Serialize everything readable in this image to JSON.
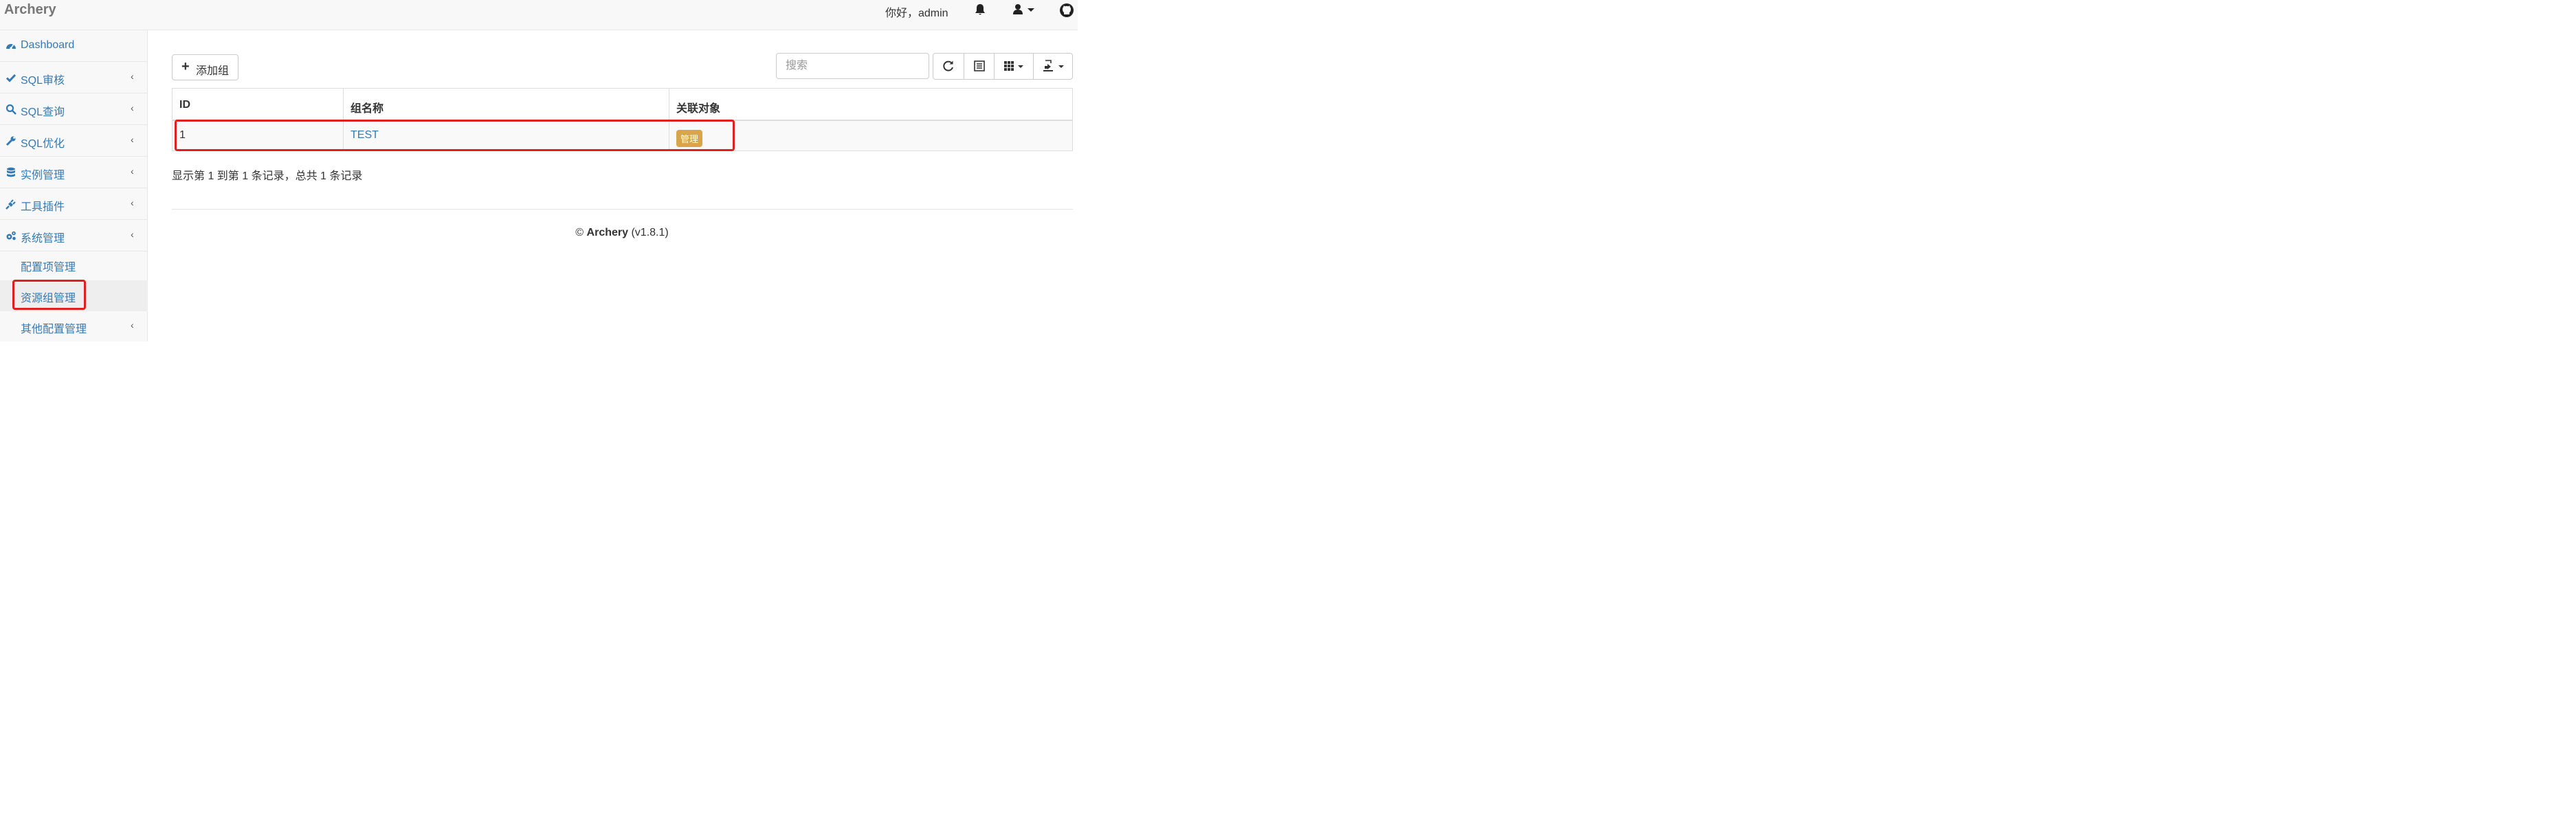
{
  "navbar": {
    "brand": "Archery",
    "greeting": "你好，admin",
    "icons": [
      "bell-icon",
      "user-icon",
      "github-icon"
    ]
  },
  "sidebar": {
    "items": [
      {
        "label": "Dashboard",
        "icon": "dashboard-icon"
      },
      {
        "label": "SQL审核",
        "icon": "check-icon",
        "chevron": "‹"
      },
      {
        "label": "SQL查询",
        "icon": "search-icon",
        "chevron": "‹"
      },
      {
        "label": "SQL优化",
        "icon": "wrench-icon",
        "chevron": "‹"
      },
      {
        "label": "实例管理",
        "icon": "database-icon",
        "chevron": "‹"
      },
      {
        "label": "工具插件",
        "icon": "plug-icon",
        "chevron": "‹"
      },
      {
        "label": "系统管理",
        "icon": "cogs-icon",
        "chevron": "‹"
      }
    ],
    "sub_items": [
      {
        "label": "配置项管理"
      },
      {
        "label": "资源组管理",
        "active": true
      },
      {
        "label": "其他配置管理",
        "chevron": "‹"
      }
    ]
  },
  "toolbar": {
    "add_label": "添加组",
    "search_placeholder": "搜索",
    "buttons": [
      "refresh-icon",
      "list-icon",
      "columns-icon",
      "export-icon"
    ]
  },
  "table": {
    "columns": [
      "ID",
      "组名称",
      "关联对象"
    ],
    "rows": [
      {
        "id": "1",
        "name": "TEST",
        "action": "管理"
      }
    ]
  },
  "records_text": "显示第 1 到第 1 条记录，总共 1 条记录",
  "footer": {
    "copyright": "©",
    "name": "Archery",
    "version": "(v1.8.1)"
  },
  "colors": {
    "accent": "#337ab7",
    "highlight": "#e02020",
    "badge": "#d9a54b"
  }
}
